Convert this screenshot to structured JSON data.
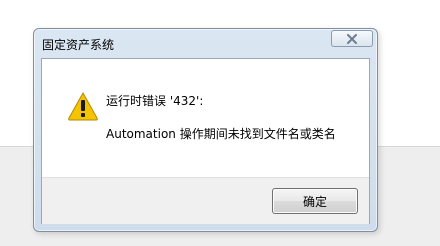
{
  "dialog": {
    "title": "固定资产系统",
    "close_icon": "close-icon",
    "icon": "warning-icon",
    "message_title": "运行时错误 '432':",
    "message_body": "Automation 操作期间未找到文件名或类名",
    "ok_label": "确定"
  },
  "colors": {
    "warning_fill": "#f5c400",
    "close_x": "#6d7d91",
    "title_bar": "#d5e1ef"
  }
}
